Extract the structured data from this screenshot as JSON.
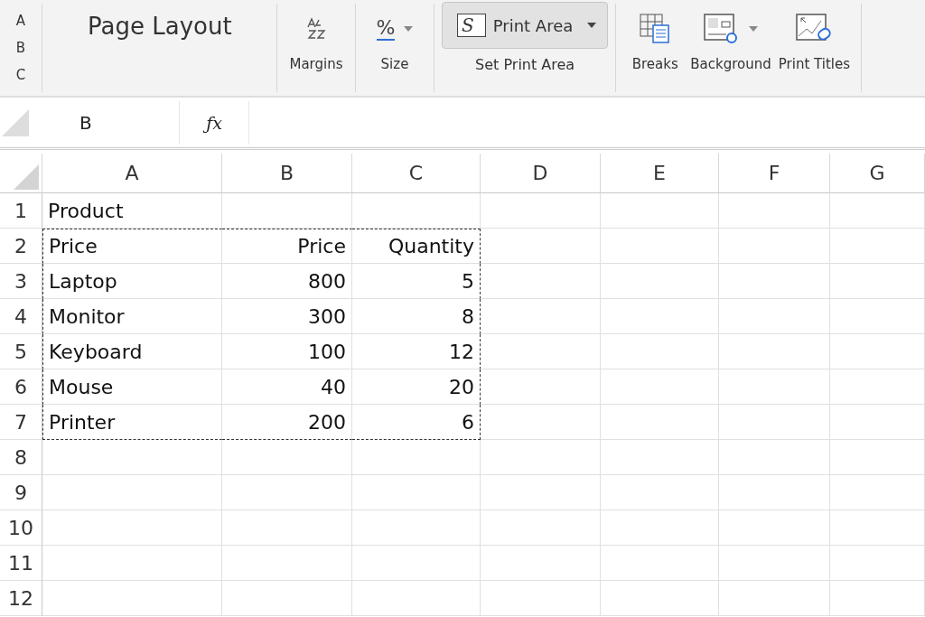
{
  "ribbon": {
    "side_letters": [
      "A",
      "B",
      "C"
    ],
    "title": "Page Layout",
    "groups": [
      {
        "kind": "buttons",
        "buttons": [
          {
            "label": "Margins",
            "caret": false
          }
        ]
      },
      {
        "kind": "buttons",
        "buttons": [
          {
            "label": "Size",
            "icon_text": "%",
            "caret": true
          }
        ]
      },
      {
        "kind": "split",
        "button": {
          "label": "Print Area",
          "icon_text": "S",
          "caret": true,
          "selected": true
        },
        "label": "Set Print Area"
      },
      {
        "kind": "buttons",
        "buttons": [
          {
            "label": "Breaks",
            "caret": false
          },
          {
            "label": "Background",
            "caret": true
          },
          {
            "label": "Print Titles",
            "caret": false
          }
        ]
      }
    ]
  },
  "formula_bar": {
    "name_box": "B",
    "fx": "ƒx"
  },
  "sheet": {
    "columns": [
      {
        "label": "A",
        "kind": "text",
        "in_print_area": true
      },
      {
        "label": "B",
        "kind": "number",
        "in_print_area": true
      },
      {
        "label": "C",
        "kind": "number",
        "in_print_area": true
      },
      {
        "label": "D",
        "kind": "text",
        "in_print_area": false
      },
      {
        "label": "E",
        "kind": "text",
        "in_print_area": false
      },
      {
        "label": "F",
        "kind": "text",
        "in_print_area": false
      },
      {
        "label": "G",
        "kind": "text",
        "in_print_area": false
      }
    ],
    "rows": [
      {
        "label": "1",
        "in_print_area": false,
        "cells": [
          "Product"
        ]
      },
      {
        "label": "2",
        "in_print_area": true,
        "cells": [
          "Price",
          "Price",
          "Quantity"
        ]
      },
      {
        "label": "3",
        "in_print_area": true,
        "cells": [
          "Laptop",
          "800",
          "5"
        ]
      },
      {
        "label": "4",
        "in_print_area": true,
        "cells": [
          "Monitor",
          "300",
          "8"
        ]
      },
      {
        "label": "5",
        "in_print_area": true,
        "cells": [
          "Keyboard",
          "100",
          "12"
        ]
      },
      {
        "label": "6",
        "in_print_area": true,
        "cells": [
          "Mouse",
          "40",
          "20"
        ]
      },
      {
        "label": "7",
        "in_print_area": true,
        "cells": [
          "Printer",
          "200",
          "6"
        ]
      },
      {
        "label": "8",
        "in_print_area": false
      },
      {
        "label": "9",
        "in_print_area": false
      },
      {
        "label": "10",
        "in_print_area": false
      },
      {
        "label": "11",
        "in_print_area": false
      },
      {
        "label": "12",
        "in_print_area": false
      }
    ]
  }
}
